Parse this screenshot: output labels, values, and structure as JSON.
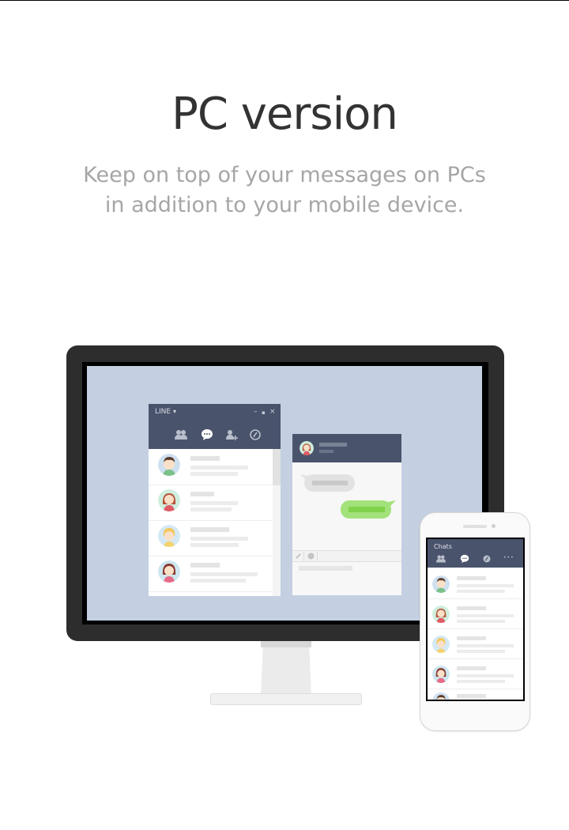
{
  "headline": "PC version",
  "subtitle": {
    "line1": "Keep on top of your messages on PCs",
    "line2": "in addition to your mobile device."
  },
  "pc_window": {
    "app_label": "LINE",
    "dropdown_glyph": "▾",
    "window_controls": [
      "–",
      "▪",
      "×"
    ],
    "tabs": [
      "friends-icon",
      "chats-icon",
      "add-friend-icon",
      "timeline-icon"
    ],
    "active_tab": "chats-icon"
  },
  "phone": {
    "header_title": "Chats",
    "tabs": [
      "friends-icon",
      "chats-icon",
      "timeline-icon",
      "more-icon"
    ],
    "more_glyph": "•••"
  },
  "colors": {
    "header": "#4a536c",
    "screen_bg": "#c4d0e2",
    "bubble_outgoing": "#a3e27a",
    "bubble_incoming": "#e2e2e2"
  }
}
